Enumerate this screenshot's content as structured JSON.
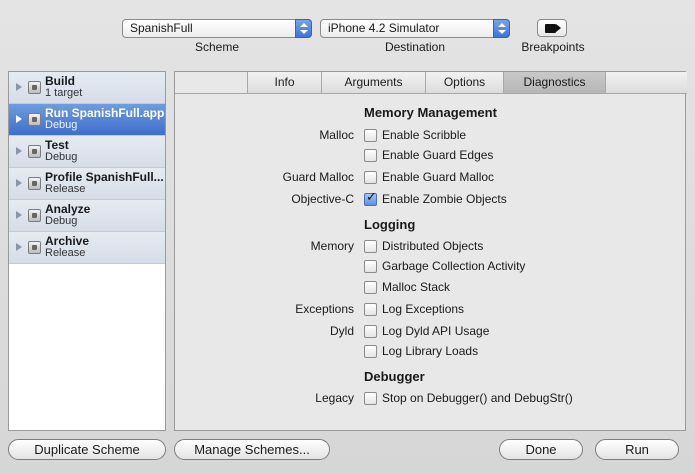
{
  "toolbar": {
    "scheme_value": "SpanishFull",
    "scheme_label": "Scheme",
    "destination_value": "iPhone 4.2 Simulator",
    "destination_label": "Destination",
    "breakpoints_label": "Breakpoints"
  },
  "sidebar": {
    "items": [
      {
        "title": "Build",
        "subtitle": "1 target"
      },
      {
        "title": "Run SpanishFull.app",
        "subtitle": "Debug"
      },
      {
        "title": "Test",
        "subtitle": "Debug"
      },
      {
        "title": "Profile SpanishFull...",
        "subtitle": "Release"
      },
      {
        "title": "Analyze",
        "subtitle": "Debug"
      },
      {
        "title": "Archive",
        "subtitle": "Release"
      }
    ]
  },
  "tabs": [
    "Info",
    "Arguments",
    "Options",
    "Diagnostics"
  ],
  "diagnostics": {
    "memory_management": {
      "title": "Memory Management",
      "malloc_label": "Malloc",
      "enable_scribble": "Enable Scribble",
      "enable_guard_edges": "Enable Guard Edges",
      "guard_malloc_label": "Guard Malloc",
      "enable_guard_malloc": "Enable Guard Malloc",
      "objective_c_label": "Objective-C",
      "enable_zombie_objects": "Enable Zombie Objects"
    },
    "logging": {
      "title": "Logging",
      "memory_label": "Memory",
      "distributed_objects": "Distributed Objects",
      "garbage_collection_activity": "Garbage Collection Activity",
      "malloc_stack": "Malloc Stack",
      "exceptions_label": "Exceptions",
      "log_exceptions": "Log Exceptions",
      "dyld_label": "Dyld",
      "log_dyld_api_usage": "Log Dyld API Usage",
      "log_library_loads": "Log Library Loads"
    },
    "debugger": {
      "title": "Debugger",
      "legacy_label": "Legacy",
      "stop_on_debugger": "Stop on Debugger() and DebugStr()"
    }
  },
  "footer": {
    "duplicate_scheme": "Duplicate Scheme",
    "manage_schemes": "Manage Schemes...",
    "done": "Done",
    "run": "Run"
  }
}
